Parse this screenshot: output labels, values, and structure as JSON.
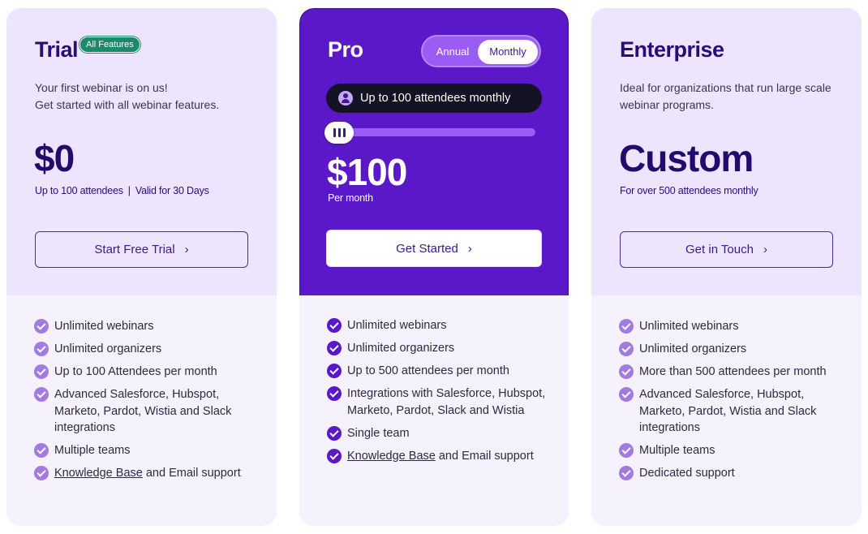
{
  "colors": {
    "pro_background": "#5a18c9",
    "light_card": "#ede4fd",
    "features_background": "#f5f1fd",
    "title_purple": "#2b0a7a",
    "badge_green": "#1b8a6b",
    "check_purple": "#a27ae0"
  },
  "trial": {
    "title": "Trial",
    "badge": "All Features",
    "desc_line1": "Your first webinar is on us!",
    "desc_line2": "Get started with all webinar features.",
    "price": "$0",
    "price_sub_a": "Up to 100 attendees",
    "price_sub_sep": "|",
    "price_sub_b": "Valid for 30 Days",
    "button": "Start Free Trial",
    "features": [
      "Unlimited webinars",
      "Unlimited organizers",
      "Up to 100 Attendees per month",
      "Advanced Salesforce, Hubspot, Marketo, Pardot, Wistia and Slack integrations",
      "Multiple teams"
    ],
    "kb_link": "Knowledge Base",
    "kb_rest": " and Email support"
  },
  "pro": {
    "title": "Pro",
    "toggle_annual": "Annual",
    "toggle_monthly": "Monthly",
    "toggle_selected": "Monthly",
    "attendees_label": "Up to 100 attendees monthly",
    "slider_level": 0,
    "price": "$100",
    "price_sub": "Per month",
    "button": "Get Started",
    "features": [
      "Unlimited webinars",
      "Unlimited organizers",
      "Up to 500 attendees per month",
      "Integrations with Salesforce, Hubspot, Marketo, Pardot, Slack and Wistia",
      "Single team"
    ],
    "kb_link": "Knowledge Base",
    "kb_rest": " and Email support"
  },
  "enterprise": {
    "title": "Enterprise",
    "desc": "Ideal for organizations that run large scale webinar programs.",
    "price": "Custom",
    "price_sub": "For over 500 attendees monthly",
    "button": "Get in Touch",
    "features": [
      "Unlimited webinars",
      "Unlimited organizers",
      "More than 500 attendees per month",
      "Advanced Salesforce, Hubspot, Marketo, Pardot, Wistia and Slack integrations",
      "Multiple teams",
      "Dedicated support"
    ]
  },
  "icons": {
    "check": "check-circle-icon",
    "chevron": "chevron-right-icon",
    "person": "person-icon",
    "slider": "slider-handle-icon"
  }
}
